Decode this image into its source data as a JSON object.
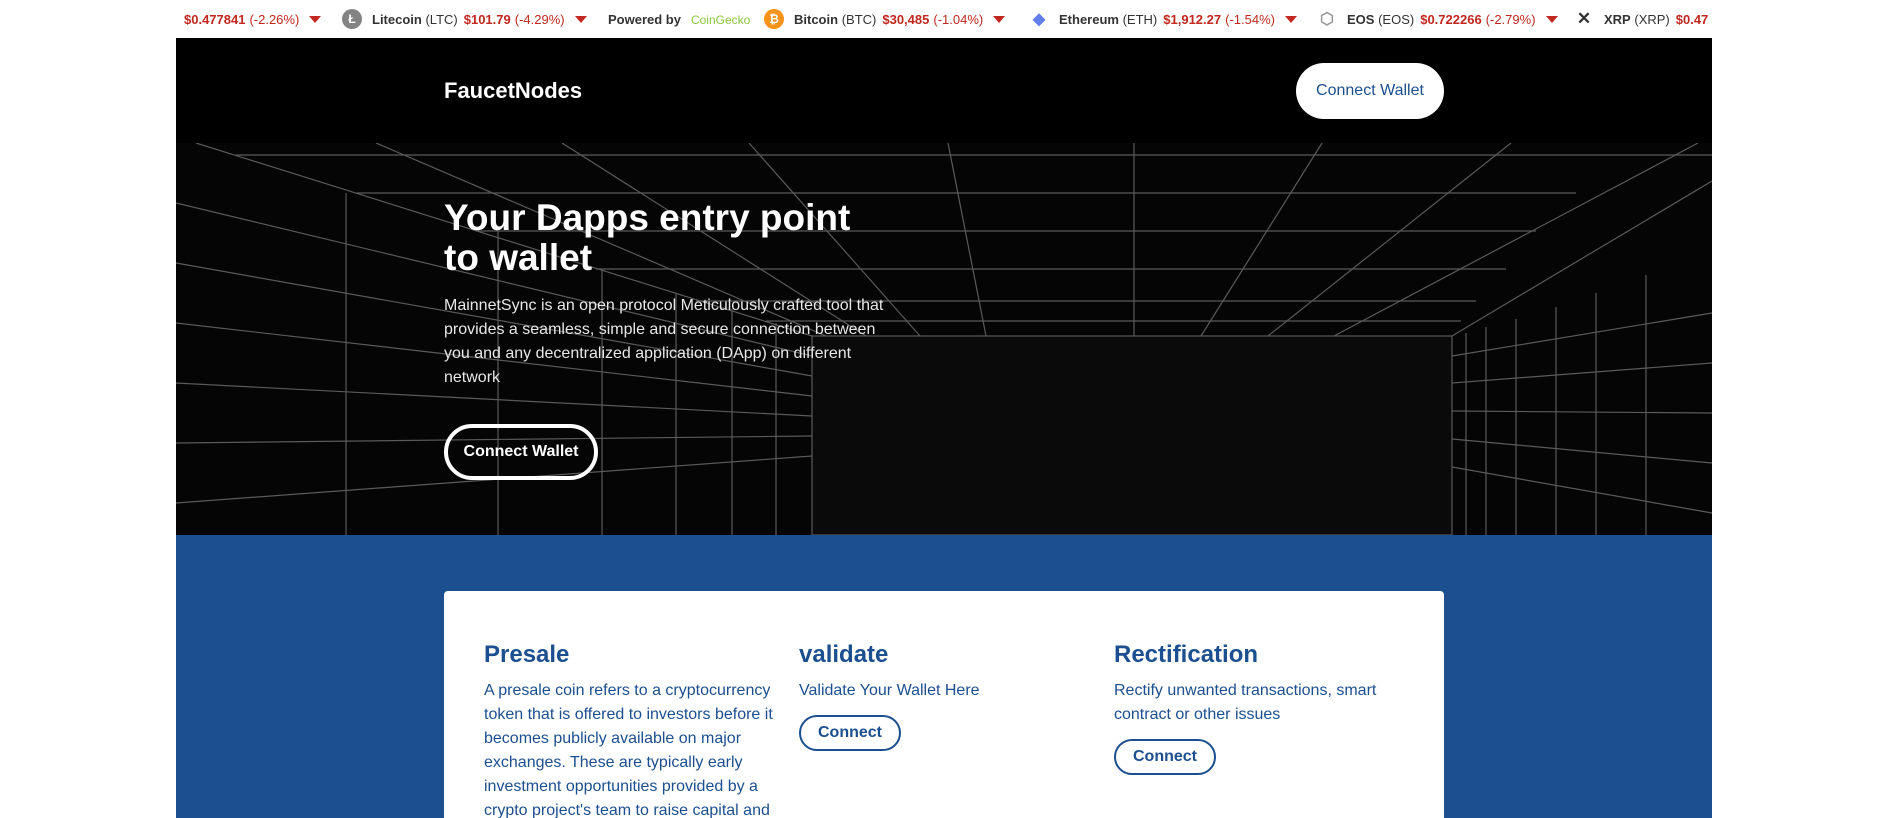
{
  "ticker": {
    "items": [
      {
        "name": "",
        "symbol": "",
        "price": "$0.477841",
        "change": "(-2.26%)",
        "icon": "xrp-partial",
        "color": ""
      },
      {
        "name": "Litecoin",
        "symbol": "(LTC)",
        "price": "$101.79",
        "change": "(-4.29%)",
        "icon": "litecoin-icon",
        "color": "#838383"
      },
      {
        "name": "Bitcoin",
        "symbol": "(BTC)",
        "price": "$30,485",
        "change": "(-1.04%)",
        "icon": "bitcoin-icon",
        "color": "#f7931a"
      },
      {
        "name": "Ethereum",
        "symbol": "(ETH)",
        "price": "$1,912.27",
        "change": "(-1.54%)",
        "icon": "ethereum-icon",
        "color": "#627eea"
      },
      {
        "name": "EOS",
        "symbol": "(EOS)",
        "price": "$0.722266",
        "change": "(-2.79%)",
        "icon": "eos-icon",
        "color": "#999"
      },
      {
        "name": "XRP",
        "symbol": "(XRP)",
        "price": "$0.47",
        "change": "",
        "icon": "xrp-icon",
        "color": "#333"
      }
    ],
    "powered_by": "Powered by",
    "powered_brand": "CoinGecko"
  },
  "nav": {
    "brand": "FaucetNodes",
    "connect_label": "Connect Wallet"
  },
  "hero": {
    "title": "Your Dapps entry point to wallet",
    "description": "MainnetSync is an open protocol Meticulously crafted tool that provides a seamless, simple and secure connection between you and any decentralized application (DApp) on different network",
    "cta_label": "Connect Wallet"
  },
  "features": [
    {
      "title": "Presale",
      "text": "A presale coin refers to a cryptocurrency token that is offered to investors before it becomes publicly available on major exchanges. These are typically early investment opportunities provided by a crypto project's team to raise capital and",
      "button": ""
    },
    {
      "title": "validate",
      "text": "Validate Your Wallet Here",
      "button": "Connect"
    },
    {
      "title": "Rectification",
      "text": "Rectify unwanted transactions, smart contract or other issues",
      "button": "Connect"
    }
  ],
  "colors": {
    "brand_blue": "#1b4f8f",
    "price_red": "#c0281f",
    "coingecko_green": "#8bc53f"
  }
}
